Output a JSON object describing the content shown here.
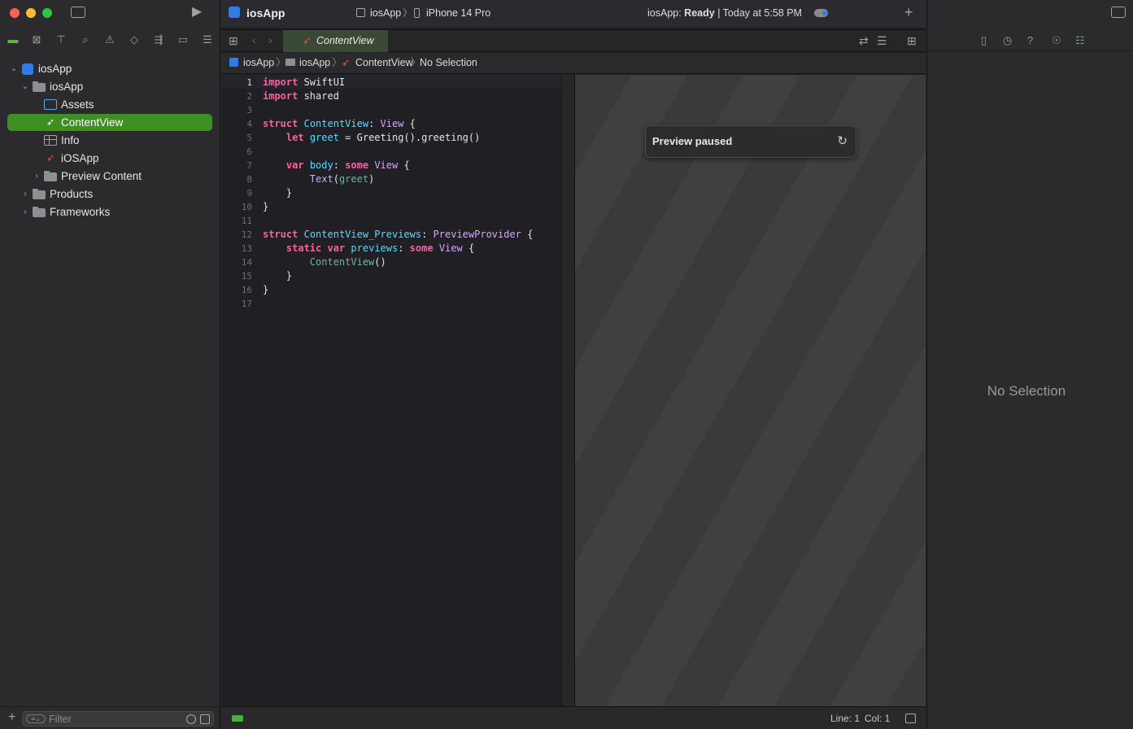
{
  "window": {
    "project_title": "iosApp"
  },
  "scheme": {
    "target": "iosApp",
    "device": "iPhone 14 Pro"
  },
  "status": {
    "prefix": "iosApp: ",
    "state": "Ready",
    "time": "| Today at 5:58 PM"
  },
  "editor_tab": {
    "label": "ContentView"
  },
  "breadcrumb": [
    "iosApp",
    "iosApp",
    "ContentView",
    "No Selection"
  ],
  "navigator": {
    "items": [
      {
        "label": "iosApp",
        "icon": "app-project-icon",
        "level": 0,
        "expanded": true
      },
      {
        "label": "iosApp",
        "icon": "folder-icon",
        "level": 1,
        "expanded": true
      },
      {
        "label": "Assets",
        "icon": "asset-catalog-icon",
        "level": 2
      },
      {
        "label": "ContentView",
        "icon": "swift-file-icon",
        "level": 2,
        "selected": true
      },
      {
        "label": "Info",
        "icon": "plist-icon",
        "level": 2
      },
      {
        "label": "iOSApp",
        "icon": "swift-file-icon",
        "level": 2
      },
      {
        "label": "Preview Content",
        "icon": "folder-icon",
        "level": 2,
        "expanded": false
      },
      {
        "label": "Products",
        "icon": "folder-icon",
        "level": 1,
        "expanded": false
      },
      {
        "label": "Frameworks",
        "icon": "folder-icon",
        "level": 1,
        "expanded": false
      }
    ],
    "filter_placeholder": "Filter"
  },
  "code_lines": [
    "1",
    "2",
    "3",
    "4",
    "5",
    "6",
    "7",
    "8",
    "9",
    "10",
    "11",
    "12",
    "13",
    "14",
    "15",
    "16",
    "17"
  ],
  "preview": {
    "message": "Preview paused"
  },
  "statusbar": {
    "line": "Line: 1",
    "col": "Col: 1"
  },
  "inspector": {
    "empty_text": "No Selection"
  },
  "colors": {
    "accent_selection": "#3e8e24",
    "keyword": "#fc5fa3",
    "type": "#d0a8ff"
  }
}
